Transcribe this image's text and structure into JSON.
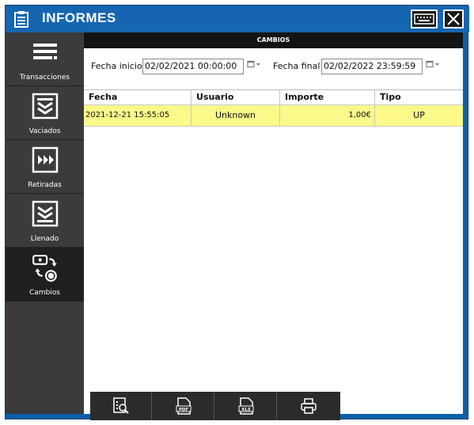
{
  "window": {
    "title": "INFORMES"
  },
  "sidebar": {
    "items": [
      {
        "label": "Transacciones"
      },
      {
        "label": "Vaciados"
      },
      {
        "label": "Retiradas"
      },
      {
        "label": "Llenado"
      },
      {
        "label": "Cambios"
      }
    ]
  },
  "section": {
    "header": "CAMBIOS"
  },
  "filters": {
    "start_label": "Fecha inicio",
    "start_value": "02/02/2021 00:00:00",
    "end_label": "Fecha final",
    "end_value": "02/02/2022 23:59:59"
  },
  "table": {
    "columns": [
      "Fecha",
      "Usuario",
      "Importe",
      "Tipo"
    ],
    "rows": [
      [
        "2021-12-21 15:55:05",
        "Unknown",
        "1,00€",
        "UP"
      ]
    ]
  },
  "toolbar": {
    "buttons": [
      {
        "icon": "preview-icon"
      },
      {
        "icon": "pdf-icon",
        "text": "PDF"
      },
      {
        "icon": "xls-icon",
        "text": "XLS"
      },
      {
        "icon": "print-icon"
      }
    ]
  },
  "colors": {
    "title_bar": "#1565b0",
    "frame": "#0e5fa8",
    "sidebar": "#3b3b3b",
    "sidebar_active": "#1f1f1f",
    "row_highlight": "#fbf98a"
  }
}
